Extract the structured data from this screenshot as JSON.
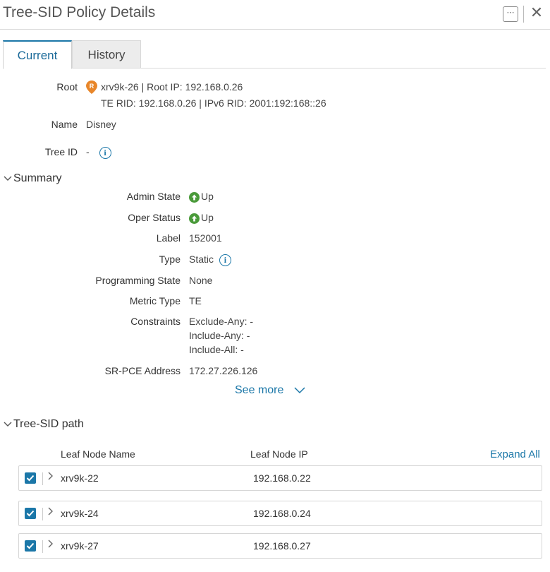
{
  "header": {
    "title": "Tree-SID Policy Details",
    "more_glyph": "⋯",
    "close_glyph": "✕"
  },
  "tabs": [
    {
      "label": "Current",
      "active": true
    },
    {
      "label": "History",
      "active": false
    }
  ],
  "root": {
    "label": "Root",
    "badge_letter": "R",
    "line1": "xrv9k-26 | Root IP: 192.168.0.26",
    "line2": "TE RID: 192.168.0.26 | IPv6 RID: 2001:192:168::26"
  },
  "name": {
    "label": "Name",
    "value": "Disney"
  },
  "tree_id": {
    "label": "Tree ID",
    "value": "-"
  },
  "summary": {
    "title": "Summary",
    "admin_state": {
      "label": "Admin State",
      "value": "Up"
    },
    "oper_status": {
      "label": "Oper Status",
      "value": "Up"
    },
    "label_field": {
      "label": "Label",
      "value": "152001"
    },
    "type": {
      "label": "Type",
      "value": "Static"
    },
    "programming_state": {
      "label": "Programming State",
      "value": "None"
    },
    "metric_type": {
      "label": "Metric Type",
      "value": "TE"
    },
    "constraints": {
      "label": "Constraints",
      "values": [
        "Exclude-Any: -",
        "Include-Any: -",
        "Include-All: -"
      ]
    },
    "srpce": {
      "label": "SR-PCE Address",
      "value": "172.27.226.126"
    },
    "see_more": "See more"
  },
  "tree_path": {
    "title": "Tree-SID path",
    "col_name": "Leaf Node Name",
    "col_ip": "Leaf Node IP",
    "expand_all": "Expand All",
    "rows": [
      {
        "name": "xrv9k-22",
        "ip": "192.168.0.22",
        "checked": true
      },
      {
        "name": "xrv9k-24",
        "ip": "192.168.0.24",
        "checked": true
      },
      {
        "name": "xrv9k-27",
        "ip": "192.168.0.27",
        "checked": true
      }
    ]
  },
  "colors": {
    "accent": "#1b77a8",
    "up_green": "#4a9a3a",
    "root_badge": "#e8862a"
  }
}
